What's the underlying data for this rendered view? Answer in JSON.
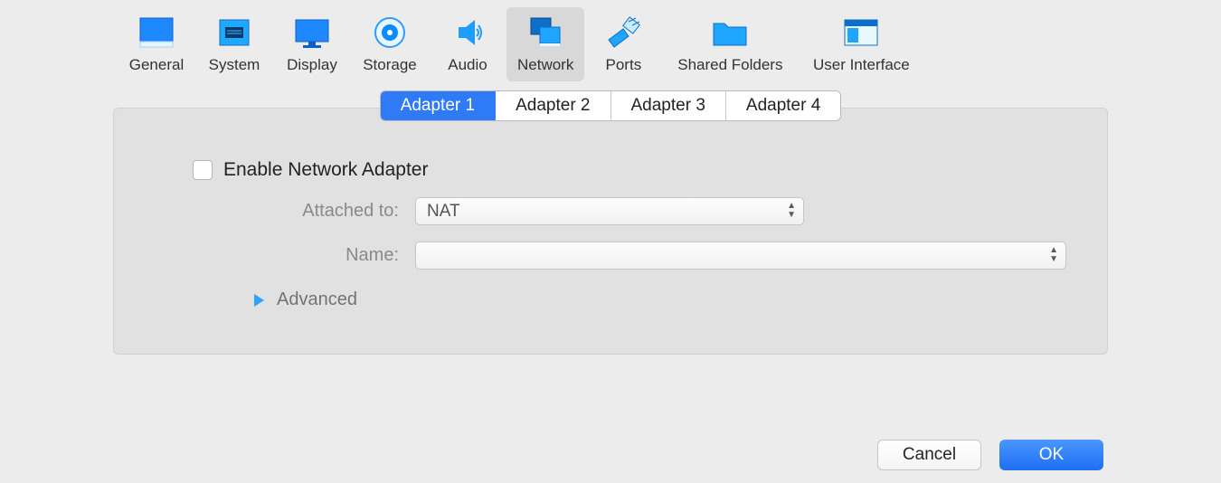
{
  "toolbar": {
    "general": {
      "label": "General"
    },
    "system": {
      "label": "System"
    },
    "display": {
      "label": "Display"
    },
    "storage": {
      "label": "Storage"
    },
    "audio": {
      "label": "Audio"
    },
    "network": {
      "label": "Network"
    },
    "ports": {
      "label": "Ports"
    },
    "shared_folders": {
      "label": "Shared Folders"
    },
    "user_interface": {
      "label": "User Interface"
    }
  },
  "tabs": {
    "a1": "Adapter 1",
    "a2": "Adapter 2",
    "a3": "Adapter 3",
    "a4": "Adapter 4"
  },
  "form": {
    "enable_label": "Enable Network Adapter",
    "attached_label": "Attached to:",
    "attached_value": "NAT",
    "name_label": "Name:",
    "name_value": "",
    "advanced_label": "Advanced"
  },
  "buttons": {
    "cancel": "Cancel",
    "ok": "OK"
  }
}
